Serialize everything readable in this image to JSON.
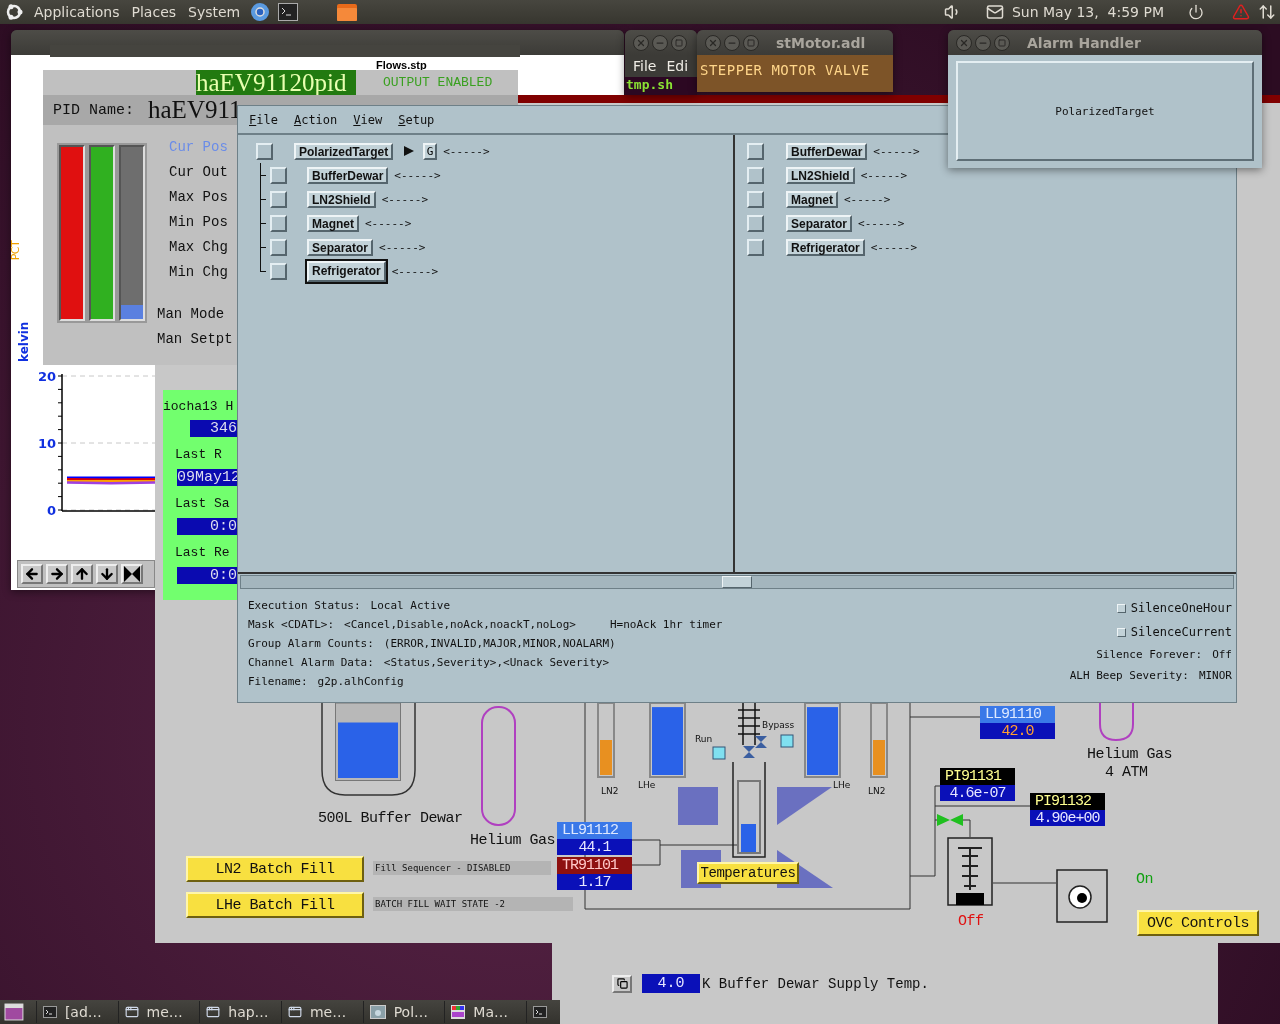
{
  "top_panel": {
    "menus": [
      "Applications",
      "Places",
      "System"
    ],
    "clock": "Sun May 13,  4:59 PM"
  },
  "graph_window": {
    "heading": "Flows.stp",
    "second_axis_label": "PCT",
    "chart_data": {
      "type": "line",
      "ylabel": "kelvin",
      "ylim": [
        0,
        20
      ],
      "yticks": [
        0,
        10,
        20
      ],
      "series": [
        {
          "color": "#0000ff",
          "values": [
            4.8,
            4.8,
            4.8
          ]
        },
        {
          "color": "#e00000",
          "values": [
            4.6,
            4.5,
            4.6
          ]
        },
        {
          "color": "#ffa000",
          "values": [
            4.3,
            4.3,
            4.3
          ]
        },
        {
          "color": "#a040e0",
          "values": [
            4.1,
            4.0,
            4.1
          ]
        }
      ]
    }
  },
  "pid_window": {
    "pv_name": "haEV91120pid",
    "output_status": "OUTPUT ENABLED",
    "name_label": "PID Name:",
    "name_value": "haEV911",
    "bars": [
      {
        "color": "#e01010",
        "level": 1
      },
      {
        "color": "#30b020",
        "level": 1
      },
      {
        "color": "#5a80e0",
        "level": 0.08
      }
    ],
    "labels": [
      {
        "text": "Cur Pos",
        "highlighted": true
      },
      {
        "text": "Cur Out",
        "highlighted": false
      },
      {
        "text": "Max Pos",
        "highlighted": false
      },
      {
        "text": "Min Pos",
        "highlighted": false
      },
      {
        "text": "Max Chg",
        "highlighted": false
      },
      {
        "text": "Min Chg",
        "highlighted": false
      }
    ],
    "mode_labels": [
      "Man Mode",
      "Man Setpt"
    ]
  },
  "ioc_panel": {
    "title": "iocha13 H",
    "rows": [
      {
        "kind": "value",
        "text": "346"
      },
      {
        "kind": "label",
        "text": "Last R"
      },
      {
        "kind": "value",
        "text": "09May12"
      },
      {
        "kind": "label",
        "text": "Last Sa"
      },
      {
        "kind": "value",
        "text": "0:0"
      },
      {
        "kind": "label",
        "text": "Last Re"
      },
      {
        "kind": "value",
        "text": "0:0"
      }
    ]
  },
  "terminal_window": {
    "menus": [
      "File",
      "Edi"
    ],
    "prompt": "tmp.sh"
  },
  "motor_window": {
    "title": "stMotor.adl",
    "banner": "STEPPER MOTOR VALVE"
  },
  "alarm_summary_window": {
    "title": "Alarm Handler",
    "group": "PolarizedTarget"
  },
  "alarm_main": {
    "menus": [
      "File",
      "Action",
      "View",
      "Setup"
    ],
    "tree": {
      "label": "PolarizedTarget",
      "checked": false,
      "selected": false,
      "status": "<----->",
      "group_button": "G",
      "children": [
        {
          "label": "BufferDewar",
          "checked": false,
          "selected": false,
          "status": "<----->"
        },
        {
          "label": "LN2Shield",
          "checked": false,
          "selected": false,
          "status": "<----->"
        },
        {
          "label": "Magnet",
          "checked": false,
          "selected": false,
          "status": "<----->"
        },
        {
          "label": "Separator",
          "checked": false,
          "selected": false,
          "status": "<----->"
        },
        {
          "label": "Refrigerator",
          "checked": false,
          "selected": true,
          "status": "<----->"
        }
      ]
    },
    "channels": [
      {
        "label": "BufferDewar",
        "checked": false,
        "selected": false,
        "status": "<----->"
      },
      {
        "label": "LN2Shield",
        "checked": false,
        "selected": false,
        "status": "<----->"
      },
      {
        "label": "Magnet",
        "checked": false,
        "selected": false,
        "status": "<----->"
      },
      {
        "label": "Separator",
        "checked": false,
        "selected": false,
        "status": "<----->"
      },
      {
        "label": "Refrigerator",
        "checked": false,
        "selected": false,
        "status": "<----->"
      }
    ],
    "status_lines": [
      {
        "label": "Execution Status:",
        "value": "Local Active"
      },
      {
        "label": "Mask <CDATL>:",
        "value": "<Cancel,Disable,noAck,noackT,noLog>",
        "note": "H=noAck 1hr timer"
      },
      {
        "label": "Group Alarm Counts:",
        "value": "(ERROR,INVALID,MAJOR,MINOR,NOALARM)"
      },
      {
        "label": "Channel Alarm Data:",
        "value": "<Status,Severity>,<Unack Severity>"
      },
      {
        "label": "Filename:",
        "value": "g2p.alhConfig"
      }
    ],
    "options": [
      {
        "label": "SilenceOneHour",
        "checked": false
      },
      {
        "label": "SilenceCurrent",
        "checked": false
      }
    ],
    "settings": [
      {
        "label": "Silence Forever:",
        "value": "Off"
      },
      {
        "label": "ALH Beep Severity:",
        "value": "MINOR"
      }
    ]
  },
  "diagram": {
    "dewar": {
      "label": "500L Buffer Dewar",
      "level": 0.75
    },
    "gas_left": "Helium Gas",
    "gas_right": [
      "Helium Gas",
      "4 ATM"
    ],
    "fill_buttons": [
      {
        "label": "LN2 Batch Fill",
        "status": "Fill Sequencer - DISABLED"
      },
      {
        "label": "LHe Batch Fill",
        "status": "BATCH FILL WAIT STATE -2"
      }
    ],
    "tanks": [
      {
        "label": "LN2",
        "kind": "ln2",
        "level": 0.5
      },
      {
        "label": "LHe",
        "kind": "lhe",
        "level": 0.97
      },
      {
        "label": "LHe",
        "kind": "lhe",
        "level": 0.97
      },
      {
        "label": "LN2",
        "kind": "ln2",
        "level": 0.5
      }
    ],
    "column": {
      "level": 0.4
    },
    "valves": [
      "Run",
      "Bypass"
    ],
    "readouts": [
      {
        "name": "LL91112",
        "value": "44.1",
        "kind": "level",
        "alarm": false
      },
      {
        "name": "TR91101",
        "value": "1.17",
        "kind": "temperature",
        "alarm": false
      },
      {
        "name": "LL91110",
        "value": "42.0",
        "kind": "level",
        "alarm": true
      },
      {
        "name": "PI91131",
        "value": "4.6e-07",
        "kind": "pressure",
        "alarm": false
      },
      {
        "name": "PI91132",
        "value": "4.90e+00",
        "kind": "pressure",
        "alarm": false
      }
    ],
    "temperatures_button": "Temperatures",
    "pump": {
      "state": "Off",
      "on": false
    },
    "gauge": {
      "state": "On",
      "on": true
    },
    "ovc_button": "OVC Controls"
  },
  "taskbar": {
    "items": [
      {
        "label": "[ad…",
        "kind": "terminal"
      },
      {
        "label": "me…",
        "kind": "window"
      },
      {
        "label": "hap…",
        "kind": "window"
      },
      {
        "label": "me…",
        "kind": "window"
      },
      {
        "label": "Pol…",
        "kind": "alarm"
      },
      {
        "label": "Ma…",
        "kind": "palette"
      }
    ]
  },
  "status_window": {
    "value": "4.0",
    "label": "K Buffer Dewar Supply Temp."
  }
}
